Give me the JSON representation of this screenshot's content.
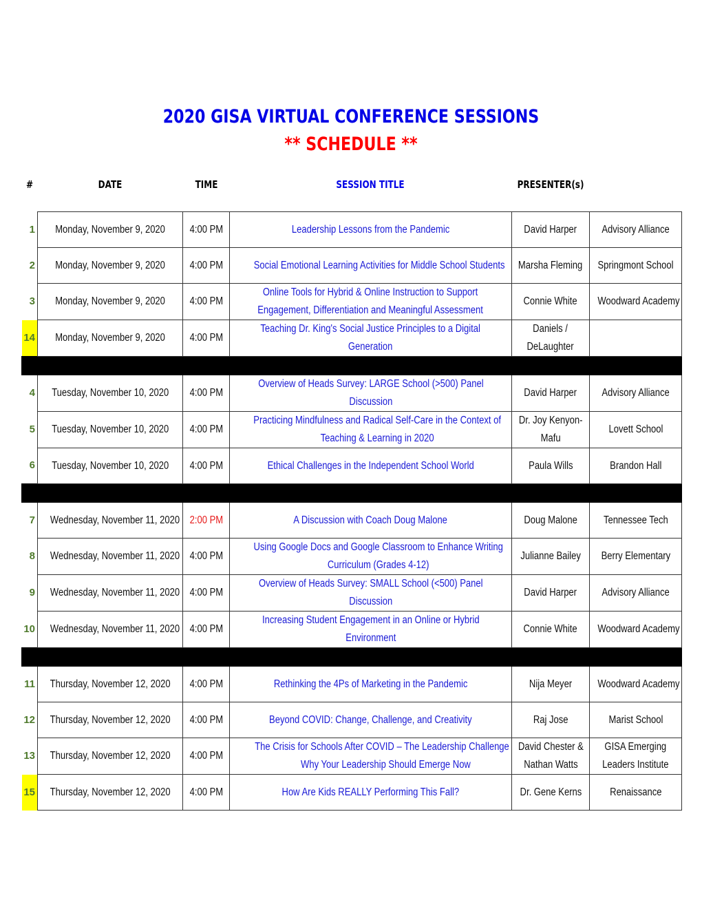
{
  "title": "2020 GISA VIRTUAL CONFERENCE SESSIONS",
  "subtitle": "** SCHEDULE **",
  "colors": {
    "title": "#0000e6",
    "subtitle": "#ff0000",
    "session_title": "#1a1ad6",
    "number": "#4e7a2c",
    "highlight": "#ffff00",
    "time_alert": "#e61919"
  },
  "headers": {
    "num": "#",
    "date": "DATE",
    "time": "TIME",
    "session": "SESSION TITLE",
    "presenters": "PRESENTER(s)"
  },
  "sessions": [
    {
      "num": "1",
      "date": "Monday, November 9, 2020",
      "time": "4:00 PM",
      "title": [
        "Leadership Lessons from the Pandemic"
      ],
      "presenter": [
        "David Harper"
      ],
      "org": [
        "Advisory Alliance"
      ]
    },
    {
      "num": "2",
      "date": "Monday, November 9, 2020",
      "time": "4:00 PM",
      "title": [
        "Social Emotional Learning Activities for Middle School Students"
      ],
      "presenter": [
        "Marsha Fleming"
      ],
      "org": [
        "Springmont School"
      ]
    },
    {
      "num": "3",
      "date": "Monday, November 9, 2020",
      "time": "4:00 PM",
      "title": [
        "Online Tools for Hybrid & Online Instruction to Support",
        "Engagement, Differentiation and Meaningful Assessment"
      ],
      "presenter": [
        "Connie White"
      ],
      "org": [
        "Woodward Academy"
      ]
    },
    {
      "num": "14",
      "highlight": true,
      "date": "Monday, November 9, 2020",
      "time": "4:00 PM",
      "title": [
        "Teaching Dr. King's Social Justice Principles to a Digital",
        "Generation"
      ],
      "presenter": [
        "Daniels /",
        "DeLaughter"
      ],
      "org": [
        ""
      ]
    },
    {
      "separator": true
    },
    {
      "num": "4",
      "date": "Tuesday, November 10, 2020",
      "time": "4:00 PM",
      "title": [
        "Overview of Heads Survey:  LARGE School (>500) Panel",
        "Discussion"
      ],
      "presenter": [
        "David Harper"
      ],
      "org": [
        "Advisory Alliance"
      ]
    },
    {
      "num": "5",
      "date": "Tuesday, November 10, 2020",
      "time": "4:00 PM",
      "title": [
        "Practicing Mindfulness and Radical Self-Care in the Context of",
        "Teaching & Learning in 2020"
      ],
      "presenter": [
        "Dr. Joy Kenyon-",
        "Mafu"
      ],
      "org": [
        "Lovett School"
      ]
    },
    {
      "num": "6",
      "date": "Tuesday, November 10, 2020",
      "time": "4:00 PM",
      "title": [
        "Ethical Challenges in the Independent School World"
      ],
      "presenter": [
        "Paula Wills"
      ],
      "org": [
        "Brandon Hall"
      ]
    },
    {
      "separator": true
    },
    {
      "num": "7",
      "date": "Wednesday, November 11, 2020",
      "time": "2:00 PM",
      "time_alert": true,
      "title": [
        "A Discussion with Coach Doug Malone"
      ],
      "presenter": [
        "Doug Malone"
      ],
      "org": [
        "Tennessee Tech"
      ]
    },
    {
      "num": "8",
      "date": "Wednesday, November 11, 2020",
      "time": "4:00 PM",
      "title": [
        "Using Google Docs and Google Classroom to Enhance Writing",
        "Curriculum (Grades 4-12)"
      ],
      "presenter": [
        "Julianne Bailey"
      ],
      "org": [
        "Berry Elementary"
      ]
    },
    {
      "num": "9",
      "date": "Wednesday, November 11, 2020",
      "time": "4:00 PM",
      "title": [
        "Overview of Heads Survey:  SMALL School (<500) Panel",
        "Discussion"
      ],
      "presenter": [
        "David Harper"
      ],
      "org": [
        "Advisory Alliance"
      ]
    },
    {
      "num": "10",
      "date": "Wednesday, November 11, 2020",
      "time": "4:00 PM",
      "title": [
        "Increasing Student Engagement in an Online or Hybrid",
        "Environment"
      ],
      "presenter": [
        "Connie White"
      ],
      "org": [
        "Woodward Academy"
      ]
    },
    {
      "separator": true
    },
    {
      "num": "11",
      "date": "Thursday, November 12, 2020",
      "time": "4:00 PM",
      "title": [
        "Rethinking the 4Ps of Marketing in the Pandemic"
      ],
      "presenter": [
        "Nija Meyer"
      ],
      "org": [
        "Woodward Academy"
      ]
    },
    {
      "num": "12",
      "date": "Thursday, November 12, 2020",
      "time": "4:00 PM",
      "title": [
        "Beyond COVID: Change, Challenge, and Creativity"
      ],
      "presenter": [
        "Raj Jose"
      ],
      "org": [
        "Marist School"
      ]
    },
    {
      "num": "13",
      "date": "Thursday, November 12, 2020",
      "time": "4:00 PM",
      "title": [
        "The Crisis for Schools After COVID – The Leadership Challenge –",
        "Why Your Leadership Should Emerge Now"
      ],
      "presenter": [
        "David Chester &",
        "Nathan Watts"
      ],
      "org": [
        "GISA Emerging",
        "Leaders Institute"
      ]
    },
    {
      "num": "15",
      "highlight": true,
      "date": "Thursday, November 12, 2020",
      "time": "4:00 PM",
      "title": [
        "How Are Kids REALLY Performing This Fall?"
      ],
      "presenter": [
        "Dr. Gene Kerns"
      ],
      "org": [
        "Renaissance"
      ]
    }
  ]
}
